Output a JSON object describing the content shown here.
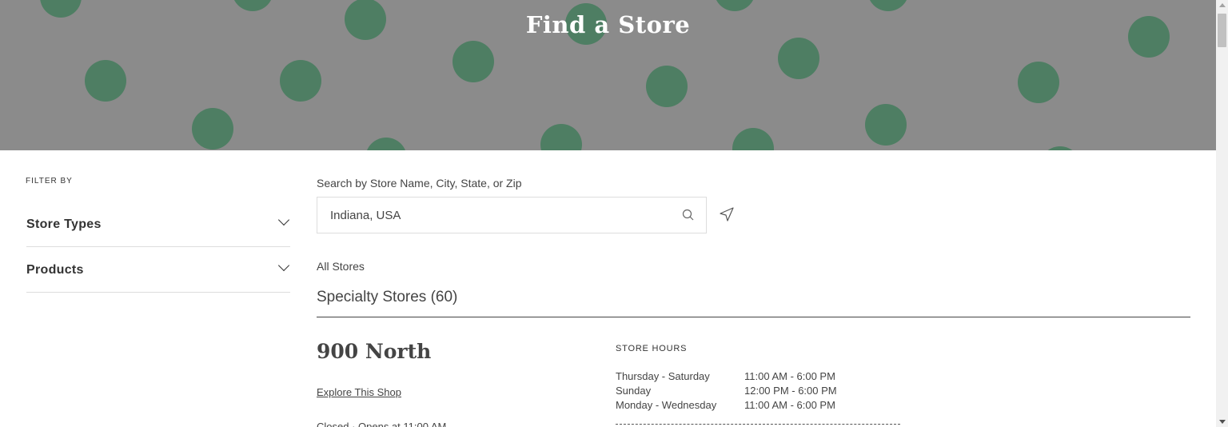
{
  "hero": {
    "title": "Find a Store"
  },
  "sidebar": {
    "filter_by_label": "FILTER BY",
    "filters": [
      {
        "label": "Store Types"
      },
      {
        "label": "Products"
      }
    ]
  },
  "search": {
    "label": "Search by Store Name, City, State, or Zip",
    "value": "Indiana, USA",
    "placeholder": "Search by Store Name, City, State, or Zip"
  },
  "results": {
    "breadcrumb": "All Stores",
    "heading": "Specialty Stores (60)",
    "store": {
      "name": "900 North",
      "link": "Explore This Shop",
      "status": "Closed · Opens at 11:00 AM",
      "hours_title": "STORE HOURS",
      "hours": [
        {
          "days": "Thursday - Saturday",
          "time": "11:00 AM - 6:00 PM"
        },
        {
          "days": "Sunday",
          "time": "12:00 PM - 6:00 PM"
        },
        {
          "days": "Monday - Wednesday",
          "time": "11:00 AM - 6:00 PM"
        }
      ]
    }
  },
  "colors": {
    "hero_bg": "#8b8b8b",
    "dot": "#4e7e63",
    "text": "#333333"
  },
  "icons": {
    "search": "search-icon",
    "locate": "location-arrow-icon",
    "expand": "chevron-down-icon"
  }
}
